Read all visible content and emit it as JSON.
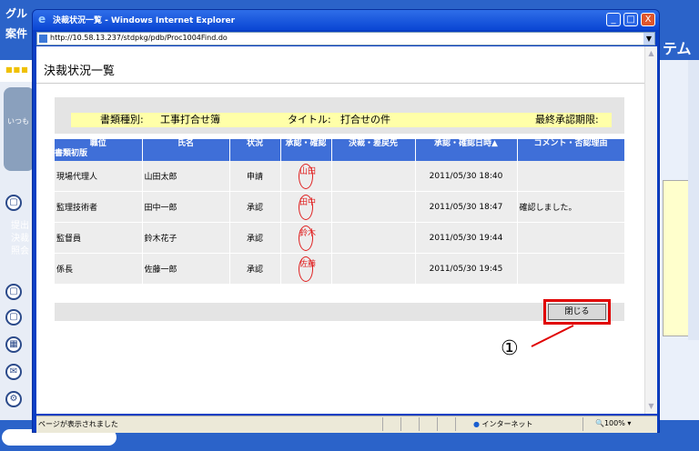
{
  "background": {
    "top_label_1": "グル",
    "top_label_2": "案件",
    "right_title": "テム",
    "user_label": "いつも",
    "side_links": [
      "提出",
      "決裁",
      "照会"
    ],
    "dots": "■■■"
  },
  "window": {
    "title": "決裁状況一覧 - Windows Internet Explorer",
    "url": "http://10.58.13.237/stdpkg/pdb/Proc1004Find.do",
    "controls": {
      "minimize": "_",
      "maximize": "□",
      "close": "X"
    }
  },
  "page": {
    "heading": "決裁状況一覧"
  },
  "doc_info": {
    "type_label": "書類種別:",
    "type_value": "工事打合せ簿",
    "title_label": "タイトル:",
    "title_value": "打合せの件",
    "deadline_label": "最終承認期限:"
  },
  "table": {
    "headers": [
      "職位",
      "氏名",
      "状況",
      "承認・確認",
      "決裁・差戻先",
      "承認・確認日時▲",
      "コメント・否認理由"
    ],
    "header_sub": "書類初版",
    "rows": [
      {
        "position": "現場代理人",
        "name": "山田太郎",
        "status": "申請",
        "stamp": "山田",
        "returned_to": "",
        "datetime": "2011/05/30 18:40",
        "comment": ""
      },
      {
        "position": "監理技術者",
        "name": "田中一郎",
        "status": "承認",
        "stamp": "田中",
        "returned_to": "",
        "datetime": "2011/05/30 18:47",
        "comment": "確認しました。"
      },
      {
        "position": "監督員",
        "name": "鈴木花子",
        "status": "承認",
        "stamp": "鈴木",
        "returned_to": "",
        "datetime": "2011/05/30 19:44",
        "comment": ""
      },
      {
        "position": "係長",
        "name": "佐藤一郎",
        "status": "承認",
        "stamp": "佐藤",
        "returned_to": "",
        "datetime": "2011/05/30 19:45",
        "comment": ""
      }
    ]
  },
  "close_button": {
    "label": "閉じる"
  },
  "annotation": {
    "number": "①",
    "color": "#e00000"
  },
  "statusbar": {
    "text": "ページが表示されました",
    "zone": "インターネット",
    "zoom": "100%"
  },
  "colors": {
    "table_header": "#3f6fd8",
    "info_bar": "#ffffa8",
    "stamp": "#e02020",
    "ie_frame": "#0a46d4"
  }
}
